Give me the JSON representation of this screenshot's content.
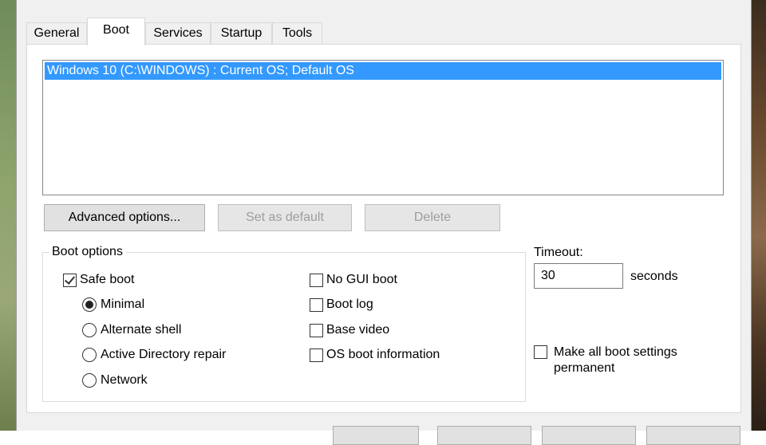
{
  "tabs": [
    "General",
    "Boot",
    "Services",
    "Startup",
    "Tools"
  ],
  "active_tab": "Boot",
  "os_list": {
    "items": [
      "Windows 10 (C:\\WINDOWS) : Current OS; Default OS"
    ],
    "selected_index": 0
  },
  "buttons": {
    "advanced": "Advanced options...",
    "set_default": "Set as default",
    "delete": "Delete"
  },
  "boot_options": {
    "title": "Boot options",
    "safe_boot": {
      "label": "Safe boot",
      "checked": true
    },
    "radios": [
      {
        "label": "Minimal",
        "selected": true
      },
      {
        "label": "Alternate shell",
        "selected": false
      },
      {
        "label": "Active Directory repair",
        "selected": false
      },
      {
        "label": "Network",
        "selected": false
      }
    ],
    "right_checks": [
      {
        "label": "No GUI boot",
        "checked": false
      },
      {
        "label": "Boot log",
        "checked": false
      },
      {
        "label": "Base video",
        "checked": false
      },
      {
        "label": "OS boot information",
        "checked": false
      }
    ]
  },
  "timeout": {
    "label": "Timeout:",
    "value": "30",
    "unit": "seconds"
  },
  "permanent": {
    "label_line1": "Make all boot settings",
    "label_line2": "permanent",
    "checked": false
  },
  "colors": {
    "selection": "#3399ff",
    "dialog_bg": "#f0f0f0",
    "panel_bg": "#ffffff"
  }
}
